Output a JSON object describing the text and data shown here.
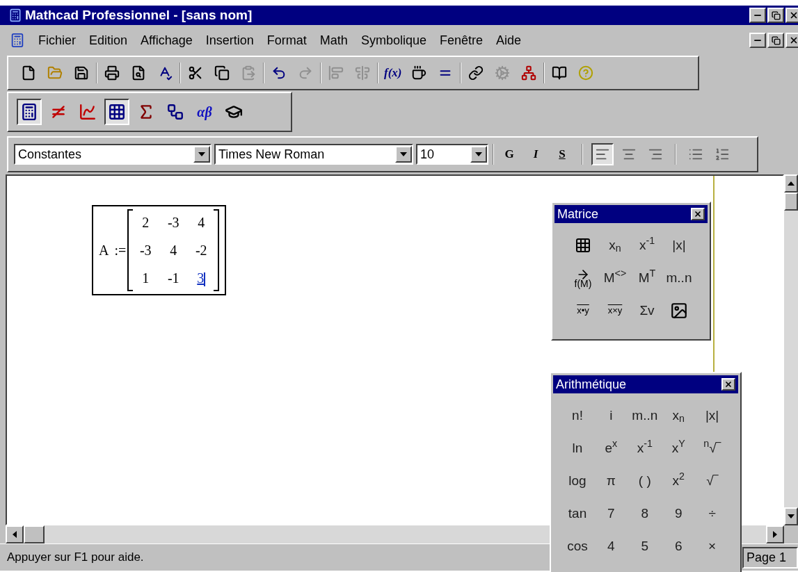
{
  "window": {
    "title": "Mathcad Professionnel - [sans nom]"
  },
  "menu": [
    {
      "label": "Fichier"
    },
    {
      "label": "Edition"
    },
    {
      "label": "Affichage"
    },
    {
      "label": "Insertion"
    },
    {
      "label": "Format"
    },
    {
      "label": "Math"
    },
    {
      "label": "Symbolique"
    },
    {
      "label": "Fenêtre"
    },
    {
      "label": "Aide"
    }
  ],
  "toolbar": [
    [
      {
        "kind": "new",
        "disabled": false
      },
      {
        "kind": "open",
        "disabled": false
      },
      {
        "kind": "save",
        "disabled": false
      }
    ],
    [
      {
        "kind": "print",
        "disabled": false
      },
      {
        "kind": "preview",
        "disabled": false
      },
      {
        "kind": "spell",
        "disabled": false
      }
    ],
    [
      {
        "kind": "cut",
        "disabled": false
      },
      {
        "kind": "copy",
        "disabled": false
      },
      {
        "kind": "paste",
        "disabled": true
      }
    ],
    [
      {
        "kind": "undo",
        "disabled": false
      },
      {
        "kind": "redo",
        "disabled": true
      }
    ],
    [
      {
        "kind": "alignh",
        "disabled": true
      },
      {
        "kind": "alignv",
        "disabled": true
      }
    ],
    [
      {
        "kind": "function",
        "label": "f(x)",
        "disabled": false
      },
      {
        "kind": "units",
        "disabled": false
      },
      {
        "kind": "calc",
        "disabled": false
      }
    ],
    [
      {
        "kind": "link",
        "disabled": false
      },
      {
        "kind": "component",
        "disabled": true
      },
      {
        "kind": "network",
        "disabled": false
      }
    ],
    [
      {
        "kind": "book",
        "disabled": false
      },
      {
        "kind": "help",
        "disabled": false
      }
    ]
  ],
  "math_toolbar": [
    {
      "kind": "calculator",
      "pressed": true
    },
    {
      "kind": "evaluation",
      "pressed": false
    },
    {
      "kind": "graph",
      "pressed": false
    },
    {
      "kind": "matrix",
      "pressed": true
    },
    {
      "kind": "calculus",
      "pressed": false
    },
    {
      "kind": "programming",
      "pressed": false
    },
    {
      "kind": "greek",
      "label": "αβ",
      "pressed": false
    },
    {
      "kind": "symbolic",
      "pressed": false
    }
  ],
  "format_bar": {
    "style": "Constantes",
    "font": "Times New Roman",
    "size": "10",
    "buttons": [
      {
        "kind": "text",
        "label": "G",
        "pressed": false
      },
      {
        "kind": "text",
        "label": "I",
        "pressed": false
      },
      {
        "kind": "text",
        "label": "S",
        "pressed": false
      },
      {
        "kind": "left",
        "pressed": true
      },
      {
        "kind": "center",
        "pressed": false
      },
      {
        "kind": "right",
        "pressed": false
      },
      {
        "kind": "bullets",
        "pressed": false
      },
      {
        "kind": "numbers",
        "pressed": false
      }
    ]
  },
  "worksheet": {
    "variable": "A",
    "operator": ":=",
    "matrix": [
      [
        {
          "value": "2",
          "editing": false
        },
        {
          "value": "-3",
          "editing": false
        },
        {
          "value": "4",
          "editing": false
        }
      ],
      [
        {
          "value": "-3",
          "editing": false
        },
        {
          "value": "4",
          "editing": false
        },
        {
          "value": "-2",
          "editing": false
        }
      ],
      [
        {
          "value": "1",
          "editing": false
        },
        {
          "value": "-1",
          "editing": false
        },
        {
          "value": "3",
          "editing": true
        }
      ]
    ]
  },
  "palettes": [
    {
      "title": "Matrice",
      "items": [
        {
          "kind": "matrix"
        },
        {
          "kind": "symbol",
          "label": "x$_{n}$"
        },
        {
          "kind": "symbol",
          "label": "x$^{-1}$"
        },
        {
          "kind": "symbol",
          "label": "|x|"
        },
        {
          "kind": "arrowed",
          "label": "f(M)"
        },
        {
          "kind": "symbol",
          "label": "M$^{<>}$"
        },
        {
          "kind": "symbol",
          "label": "M$^{T}$"
        },
        {
          "kind": "symbol",
          "label": "m..n"
        },
        {
          "kind": "vector",
          "label": "x•y"
        },
        {
          "kind": "vector",
          "label": "x×y"
        },
        {
          "kind": "symbol",
          "label": "Σv"
        },
        {
          "kind": "picture"
        }
      ]
    },
    {
      "title": "Arithmétique",
      "items": [
        {
          "kind": "symbol",
          "label": "n!"
        },
        {
          "kind": "symbol",
          "label": "i"
        },
        {
          "kind": "symbol",
          "label": "m..n"
        },
        {
          "kind": "symbol",
          "label": "x$_{n}$"
        },
        {
          "kind": "symbol",
          "label": "|x|"
        },
        {
          "kind": "symbol",
          "label": "ln"
        },
        {
          "kind": "symbol",
          "label": "e$^{x}$"
        },
        {
          "kind": "symbol",
          "label": "x$^{-1}$"
        },
        {
          "kind": "symbol",
          "label": "x$^{Y}$"
        },
        {
          "kind": "symbol",
          "label": "$^{n}$√‾"
        },
        {
          "kind": "symbol",
          "label": "log"
        },
        {
          "kind": "symbol",
          "label": "π"
        },
        {
          "kind": "symbol",
          "label": "( )"
        },
        {
          "kind": "symbol",
          "label": "x$^{2}$"
        },
        {
          "kind": "symbol",
          "label": "√‾"
        },
        {
          "kind": "symbol",
          "label": "tan"
        },
        {
          "kind": "symbol",
          "label": "7"
        },
        {
          "kind": "symbol",
          "label": "8"
        },
        {
          "kind": "symbol",
          "label": "9"
        },
        {
          "kind": "symbol",
          "label": "÷"
        },
        {
          "kind": "symbol",
          "label": "cos"
        },
        {
          "kind": "symbol",
          "label": "4"
        },
        {
          "kind": "symbol",
          "label": "5"
        },
        {
          "kind": "symbol",
          "label": "6"
        },
        {
          "kind": "symbol",
          "label": "×"
        }
      ]
    }
  ],
  "status_bar": {
    "message": "Appuyer sur F1 pour aide.",
    "page": "Page 1"
  }
}
